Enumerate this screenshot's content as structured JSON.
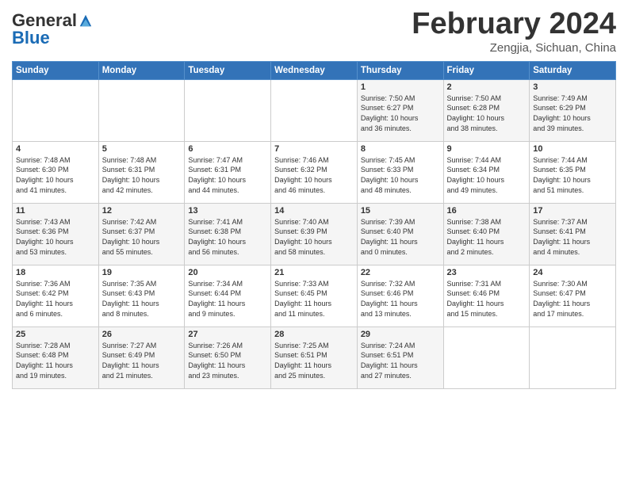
{
  "header": {
    "logo_general": "General",
    "logo_blue": "Blue",
    "month": "February 2024",
    "location": "Zengjia, Sichuan, China"
  },
  "weekdays": [
    "Sunday",
    "Monday",
    "Tuesday",
    "Wednesday",
    "Thursday",
    "Friday",
    "Saturday"
  ],
  "weeks": [
    [
      {
        "day": "",
        "info": ""
      },
      {
        "day": "",
        "info": ""
      },
      {
        "day": "",
        "info": ""
      },
      {
        "day": "",
        "info": ""
      },
      {
        "day": "1",
        "info": "Sunrise: 7:50 AM\nSunset: 6:27 PM\nDaylight: 10 hours\nand 36 minutes."
      },
      {
        "day": "2",
        "info": "Sunrise: 7:50 AM\nSunset: 6:28 PM\nDaylight: 10 hours\nand 38 minutes."
      },
      {
        "day": "3",
        "info": "Sunrise: 7:49 AM\nSunset: 6:29 PM\nDaylight: 10 hours\nand 39 minutes."
      }
    ],
    [
      {
        "day": "4",
        "info": "Sunrise: 7:48 AM\nSunset: 6:30 PM\nDaylight: 10 hours\nand 41 minutes."
      },
      {
        "day": "5",
        "info": "Sunrise: 7:48 AM\nSunset: 6:31 PM\nDaylight: 10 hours\nand 42 minutes."
      },
      {
        "day": "6",
        "info": "Sunrise: 7:47 AM\nSunset: 6:31 PM\nDaylight: 10 hours\nand 44 minutes."
      },
      {
        "day": "7",
        "info": "Sunrise: 7:46 AM\nSunset: 6:32 PM\nDaylight: 10 hours\nand 46 minutes."
      },
      {
        "day": "8",
        "info": "Sunrise: 7:45 AM\nSunset: 6:33 PM\nDaylight: 10 hours\nand 48 minutes."
      },
      {
        "day": "9",
        "info": "Sunrise: 7:44 AM\nSunset: 6:34 PM\nDaylight: 10 hours\nand 49 minutes."
      },
      {
        "day": "10",
        "info": "Sunrise: 7:44 AM\nSunset: 6:35 PM\nDaylight: 10 hours\nand 51 minutes."
      }
    ],
    [
      {
        "day": "11",
        "info": "Sunrise: 7:43 AM\nSunset: 6:36 PM\nDaylight: 10 hours\nand 53 minutes."
      },
      {
        "day": "12",
        "info": "Sunrise: 7:42 AM\nSunset: 6:37 PM\nDaylight: 10 hours\nand 55 minutes."
      },
      {
        "day": "13",
        "info": "Sunrise: 7:41 AM\nSunset: 6:38 PM\nDaylight: 10 hours\nand 56 minutes."
      },
      {
        "day": "14",
        "info": "Sunrise: 7:40 AM\nSunset: 6:39 PM\nDaylight: 10 hours\nand 58 minutes."
      },
      {
        "day": "15",
        "info": "Sunrise: 7:39 AM\nSunset: 6:40 PM\nDaylight: 11 hours\nand 0 minutes."
      },
      {
        "day": "16",
        "info": "Sunrise: 7:38 AM\nSunset: 6:40 PM\nDaylight: 11 hours\nand 2 minutes."
      },
      {
        "day": "17",
        "info": "Sunrise: 7:37 AM\nSunset: 6:41 PM\nDaylight: 11 hours\nand 4 minutes."
      }
    ],
    [
      {
        "day": "18",
        "info": "Sunrise: 7:36 AM\nSunset: 6:42 PM\nDaylight: 11 hours\nand 6 minutes."
      },
      {
        "day": "19",
        "info": "Sunrise: 7:35 AM\nSunset: 6:43 PM\nDaylight: 11 hours\nand 8 minutes."
      },
      {
        "day": "20",
        "info": "Sunrise: 7:34 AM\nSunset: 6:44 PM\nDaylight: 11 hours\nand 9 minutes."
      },
      {
        "day": "21",
        "info": "Sunrise: 7:33 AM\nSunset: 6:45 PM\nDaylight: 11 hours\nand 11 minutes."
      },
      {
        "day": "22",
        "info": "Sunrise: 7:32 AM\nSunset: 6:46 PM\nDaylight: 11 hours\nand 13 minutes."
      },
      {
        "day": "23",
        "info": "Sunrise: 7:31 AM\nSunset: 6:46 PM\nDaylight: 11 hours\nand 15 minutes."
      },
      {
        "day": "24",
        "info": "Sunrise: 7:30 AM\nSunset: 6:47 PM\nDaylight: 11 hours\nand 17 minutes."
      }
    ],
    [
      {
        "day": "25",
        "info": "Sunrise: 7:28 AM\nSunset: 6:48 PM\nDaylight: 11 hours\nand 19 minutes."
      },
      {
        "day": "26",
        "info": "Sunrise: 7:27 AM\nSunset: 6:49 PM\nDaylight: 11 hours\nand 21 minutes."
      },
      {
        "day": "27",
        "info": "Sunrise: 7:26 AM\nSunset: 6:50 PM\nDaylight: 11 hours\nand 23 minutes."
      },
      {
        "day": "28",
        "info": "Sunrise: 7:25 AM\nSunset: 6:51 PM\nDaylight: 11 hours\nand 25 minutes."
      },
      {
        "day": "29",
        "info": "Sunrise: 7:24 AM\nSunset: 6:51 PM\nDaylight: 11 hours\nand 27 minutes."
      },
      {
        "day": "",
        "info": ""
      },
      {
        "day": "",
        "info": ""
      }
    ]
  ]
}
